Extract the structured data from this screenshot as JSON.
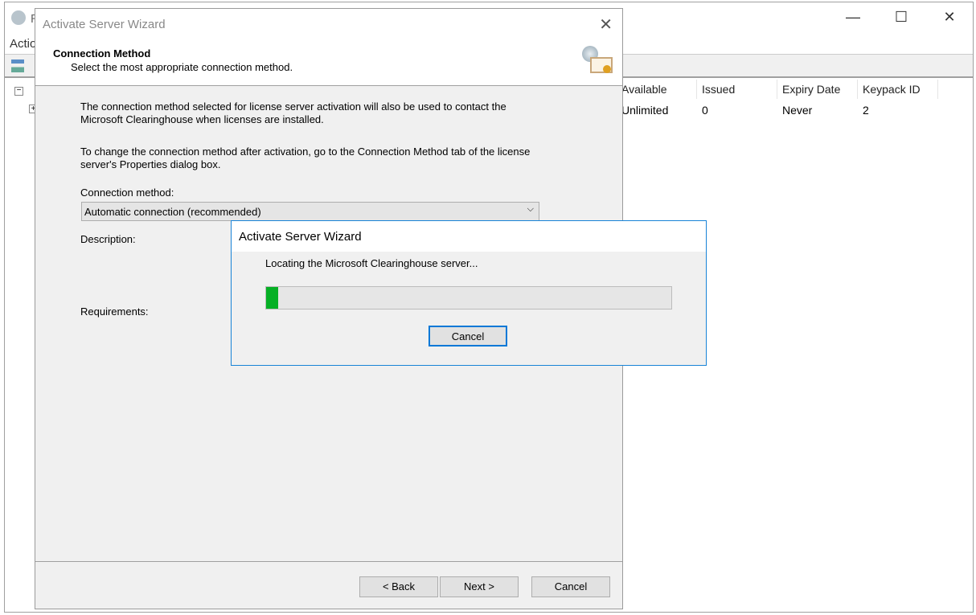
{
  "main_window": {
    "title_partial": "R",
    "menu_partial": "Actio",
    "controls": [
      "—",
      "☐",
      "✕"
    ]
  },
  "license_list": {
    "columns": [
      "Available",
      "Issued",
      "Expiry Date",
      "Keypack ID"
    ],
    "rows": [
      [
        "Unlimited",
        "0",
        "Never",
        "2"
      ]
    ]
  },
  "wizard": {
    "title": "Activate Server Wizard",
    "close": "✕",
    "header_title": "Connection Method",
    "header_subtitle": "Select the most appropriate connection method.",
    "para1": "The connection method selected for license server activation will also be used to contact the Microsoft Clearinghouse when licenses are installed.",
    "para2": "To change the connection method after activation, go to the Connection Method tab of the license server's Properties dialog box.",
    "connection_label": "Connection method:",
    "connection_value": "Automatic connection (recommended)",
    "description_label": "Description:",
    "requirements_label": "Requirements:",
    "back": "< Back",
    "next": "Next >",
    "cancel": "Cancel"
  },
  "progress_dialog": {
    "title": "Activate Server Wizard",
    "status": "Locating the Microsoft Clearinghouse server...",
    "progress_percent": 3,
    "progress_color": "#06b025",
    "cancel": "Cancel"
  }
}
